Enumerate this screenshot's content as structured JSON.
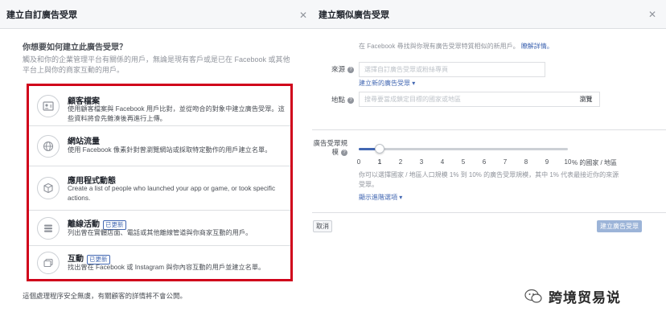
{
  "left": {
    "title": "建立自訂廣告受眾",
    "question": "你想要如何建立此廣告受眾？",
    "description": "觸及和你的企業管理平台有關係的用戶，無論是現有客戶或是已在 Facebook 或其他平台上與你的商家互動的用戶。",
    "options": [
      {
        "title": "顧客檔案",
        "subtitle": "使用顧客檔案與 Facebook 用戶比對，並從吻合的對象中建立廣告受眾。這些資料將會先雜湊後再進行上傳。",
        "badge": "",
        "icon": "customer-file-icon"
      },
      {
        "title": "網站流量",
        "subtitle": "使用 Facebook 像素針對曾瀏覽網站或採取特定動作的用戶建立名單。",
        "badge": "",
        "icon": "globe-icon"
      },
      {
        "title": "應用程式動態",
        "subtitle": "Create a list of people who launched your app or game, or took specific actions.",
        "badge": "",
        "icon": "app-cube-icon"
      },
      {
        "title": "離線活動",
        "subtitle": "列出曾在實體店面、電話或其他離線管道與你商家互動的用戶。",
        "badge": "已更新",
        "icon": "offline-store-icon"
      },
      {
        "title": "互動",
        "subtitle": "找出曾在 Facebook 或 Instagram 與你內容互動的用戶並建立名單。",
        "badge": "已更新",
        "icon": "engagement-icon"
      }
    ],
    "footer": "這個處理程序安全無虞，有關顧客的詳情將不會公開。"
  },
  "right": {
    "title": "建立類似廣告受眾",
    "info_text": "在 Facebook 尋找與你現有廣告受眾特質相似的新用戶。",
    "info_link": "瞭解詳情。",
    "source_label": "來源",
    "source_placeholder": "選擇自訂廣告受眾或粉絲專頁",
    "create_new_link": "建立新的廣告受眾 ▾",
    "location_label": "地點",
    "location_placeholder": "搜尋要當成鎖定目標的國家或地區",
    "browse_label": "瀏覽",
    "size_label": "廣告受眾規模",
    "ticks": [
      "0",
      "1",
      "2",
      "3",
      "4",
      "5",
      "6",
      "7",
      "8",
      "9",
      "10"
    ],
    "tick_suffix": "% 的國家 / 地區",
    "slider_value": 1,
    "size_hint": "你可以選擇國家 / 地區人口規模 1% 到 10% 的廣告受眾規模，其中 1% 代表最接近你的來源受眾。",
    "advanced_link": "顯示進階選項 ▾",
    "cancel_label": "取消",
    "create_label": "建立廣告受眾"
  },
  "watermark": "跨境贸易说",
  "colors": {
    "accent": "#4267b2",
    "highlight_border": "#d0021b",
    "disabled_button": "#9cb4d8"
  }
}
